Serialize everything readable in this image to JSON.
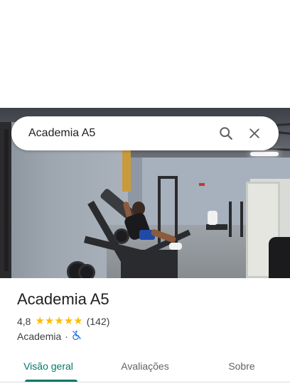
{
  "search": {
    "query": "Academia A5",
    "search_icon": "search-icon",
    "clear_icon": "close-icon"
  },
  "hero": {
    "description_icon": "place-photo"
  },
  "place": {
    "name": "Academia A5",
    "rating": "4,8",
    "stars": [
      "★",
      "★",
      "★",
      "★",
      "★"
    ],
    "star_color": "#fbbc04",
    "review_count": "(142)",
    "category": "Academia",
    "separator": "·",
    "accessibility_icon": "not-accessible-icon",
    "accessibility_icon_color": "#1a73e8"
  },
  "tabs": {
    "items": [
      {
        "label": "Visão geral",
        "active": true
      },
      {
        "label": "Avaliações",
        "active": false
      },
      {
        "label": "Sobre",
        "active": false
      }
    ],
    "accent_color": "#00796b"
  }
}
